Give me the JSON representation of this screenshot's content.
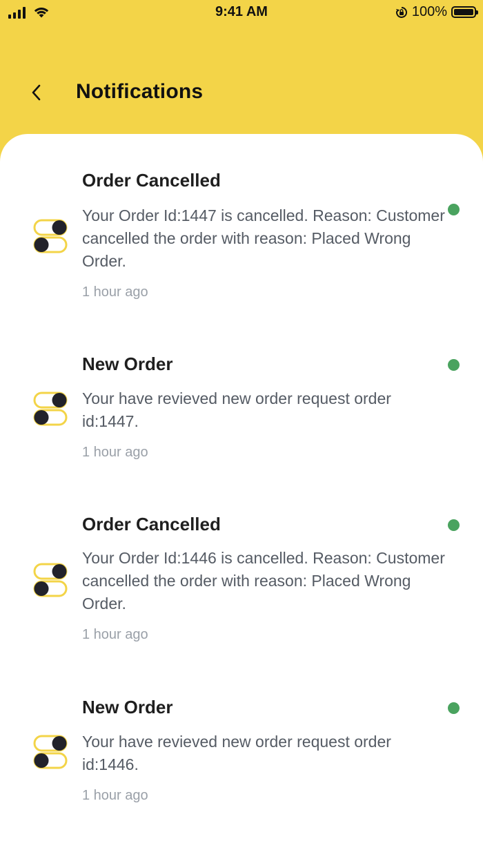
{
  "status_bar": {
    "time": "9:41 AM",
    "battery": "100%"
  },
  "header": {
    "title": "Notifications"
  },
  "colors": {
    "brand": "#F3D448",
    "unread_dot": "#4AA35F"
  },
  "notifications": [
    {
      "title": "Order Cancelled",
      "body": "Your Order Id:1447 is cancelled. Reason: Customer cancelled the order with reason: Placed Wrong Order.",
      "time": "1 hour ago",
      "icon": "toggles-icon",
      "unread": true
    },
    {
      "title": "New Order",
      "body": "Your have revieved new order request order id:1447.",
      "time": "1 hour ago",
      "icon": "toggles-icon",
      "unread": true
    },
    {
      "title": "Order Cancelled",
      "body": "Your Order Id:1446 is cancelled. Reason: Customer cancelled the order with reason: Placed Wrong Order.",
      "time": "1 hour ago",
      "icon": "toggles-icon",
      "unread": true
    },
    {
      "title": "New Order",
      "body": "Your have revieved new order request order id:1446.",
      "time": "1 hour ago",
      "icon": "toggles-icon",
      "unread": true
    }
  ]
}
